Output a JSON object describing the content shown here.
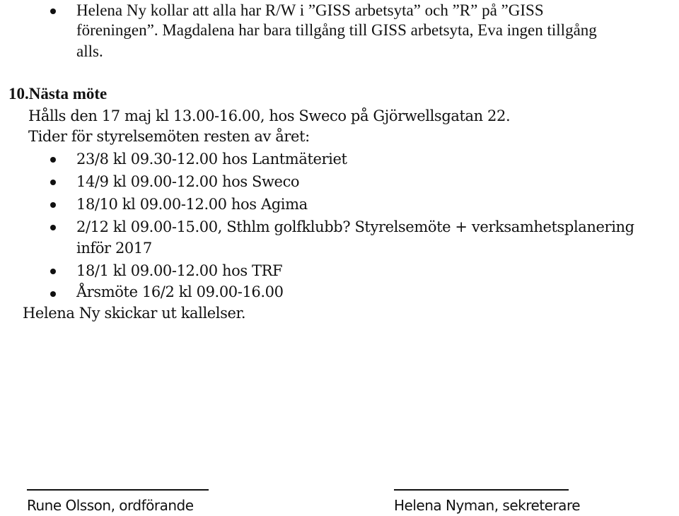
{
  "previous_item": {
    "bullet_lines": [
      "Helena Ny kollar att alla har R/W i ”GISS arbetsyta” och ”R” på ”GISS",
      "föreningen”. Magdalena har bara tillgång till GISS arbetsyta, Eva ingen tillgång",
      "alls."
    ]
  },
  "section": {
    "heading": "10.Nästa möte",
    "meeting_info": "Hålls den 17 maj kl 13.00-16.00, hos Sweco på Gjörwellsgatan 22.",
    "schedule_intro": "Tider för styrelsemöten resten av året:",
    "schedule": [
      {
        "lines": [
          "23/8 kl 09.30-12.00 hos Lantmäteriet"
        ]
      },
      {
        "lines": [
          "14/9 kl 09.00-12.00 hos Sweco"
        ]
      },
      {
        "lines": [
          "18/10 kl 09.00-12.00 hos Agima"
        ]
      },
      {
        "lines": [
          "2/12 kl 09.00-15.00, Sthlm golfklubb? Styrelsemöte + verksamhetsplanering",
          "inför 2017"
        ]
      },
      {
        "lines": [
          "18/1 kl 09.00-12.00 hos TRF"
        ]
      },
      {
        "lines": [
          "Årsmöte 16/2 kl 09.00-16.00"
        ]
      }
    ],
    "closing_note": "Helena Ny skickar ut kallelser."
  },
  "signatures": [
    {
      "label": "Rune Olsson, ordförande"
    },
    {
      "label": "Helena Nyman, sekreterare"
    }
  ]
}
